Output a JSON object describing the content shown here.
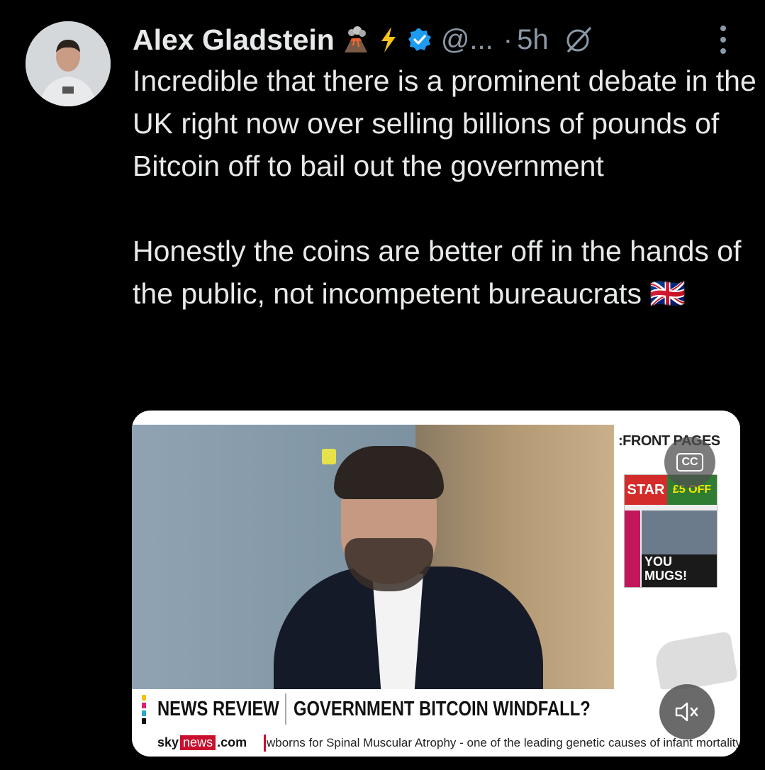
{
  "tweet": {
    "author_name": "Alex Gladstein",
    "handle": "@...",
    "separator": "·",
    "time": "5h",
    "text_paragraphs": [
      "Incredible that there is a prominent debate in the UK right now over selling billions of pounds of Bitcoin off to bail out the government",
      "Honestly the coins are better off in the hands of the public, not incompetent bureaucrats 🇬🇧"
    ],
    "icons": [
      "volcano-emoji",
      "lightning-emoji",
      "verified-badge-icon",
      "grok-icon",
      "more-options-icon"
    ]
  },
  "video": {
    "front_pages_label": ":FRONT PAGES",
    "newspaper": {
      "masthead": "STAR",
      "offer": "£5 OFF",
      "headline": "YOU MUGS!"
    },
    "cc_label": "CC",
    "lower_third": {
      "label": "NEWS REVIEW",
      "headline": "GOVERNMENT BITCOIN WINDFALL?"
    },
    "ticker": {
      "brand_sky": "sky",
      "brand_news": "news",
      "brand_com": ".com",
      "text": "wborns for Spinal Muscular Atrophy - one of the leading genetic causes of infant mortality"
    },
    "accent_colors": {
      "sky_red": "#c8102e",
      "stripe_colors": [
        "#f5c400",
        "#e0206e",
        "#2aa5d8",
        "#111111"
      ]
    }
  }
}
